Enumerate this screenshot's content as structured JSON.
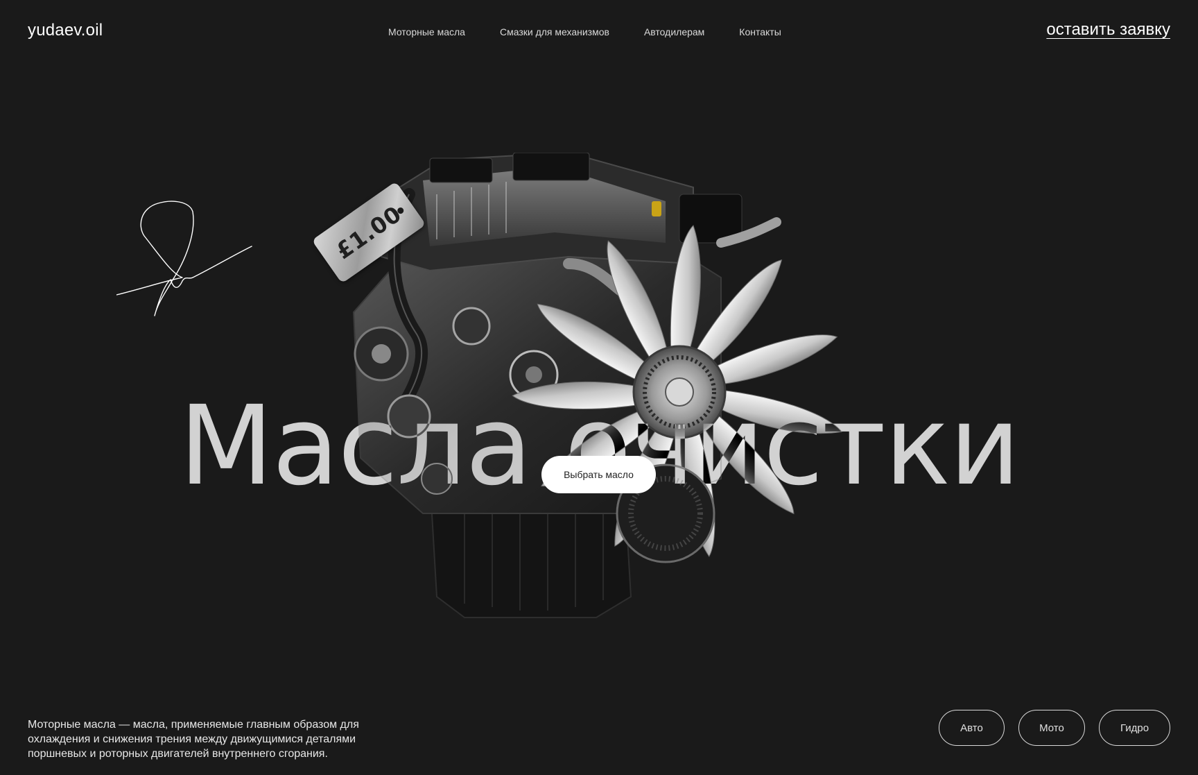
{
  "header": {
    "logo": "yudaev.oil",
    "nav": [
      "Моторные масла",
      "Смазки для механизмов",
      "Автодилерам",
      "Контакты"
    ],
    "cta": "оставить заявку"
  },
  "hero": {
    "title": "Масла очистки",
    "price_tag": "£1.00",
    "button": "Выбрать масло"
  },
  "footer": {
    "description": "Моторные масла — масла, применяемые главным образом для охлаждения и снижения трения между движущимися деталями поршневых и роторных двигателей внутреннего сгорания.",
    "categories": [
      "Авто",
      "Мото",
      "Гидро"
    ]
  },
  "icons": {
    "signature": "signature-scribble",
    "engine": "engine-image"
  },
  "colors": {
    "background": "#1a1a1a",
    "text": "#ffffff",
    "button_bg": "#ffffff"
  }
}
